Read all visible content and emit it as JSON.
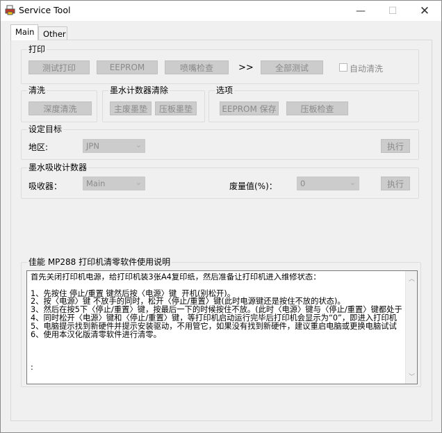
{
  "window": {
    "title": "Service Tool"
  },
  "controls": {
    "minimize": "—",
    "maximize": "☐",
    "close": "✕"
  },
  "tabs": [
    {
      "label": "Main"
    },
    {
      "label": "Other"
    }
  ],
  "print_group": {
    "title": "打印",
    "test_print": "测试打印",
    "eeprom": "EEPROM",
    "nozzle_check": "喷嘴检查",
    "arrow": ">>",
    "all_tests": "全部测试",
    "auto_clean_label": "自动清洗",
    "auto_clean_checked": false
  },
  "clean_group": {
    "title": "清洗",
    "deep_clean": "深度清洗"
  },
  "ink_counter_group": {
    "title": "墨水计数器清除",
    "main_pad": "主废墨垫",
    "platen_pad": "压板墨垫"
  },
  "options_group": {
    "title": "选项",
    "eeprom_save": "EEPROM 保存",
    "platen_check": "压板检查"
  },
  "target_group": {
    "title": "设定目标",
    "region_label": "地区:",
    "region_value": "JPN",
    "execute": "执行"
  },
  "absorber_group": {
    "title": "墨水吸收计数器",
    "absorber_label": "吸收器：",
    "absorber_value": "Main",
    "waste_label": "废量值(%)：",
    "waste_value": "0",
    "execute": "执行"
  },
  "manual": {
    "title": "佳能 MP288 打印机清零软件使用说明",
    "lines": [
      "首先关闭打印机电源，给打印机装3张A4复印纸，然后准备让打印机进入维修状态：",
      "",
      "1、先按住 停止/重置 键然后按〈电源〉键  开机(别松开)。",
      "2、按〈电源〉键 不放手的同时，松开〈停止/重置〉键(此时电源键还是按住不放的状态)。",
      "3、然后在按5下〈停止/重置〉键，按最后一下的时候按住不放。(此时〈电源〉键与〈停止/重置〉键都处于按",
      "4、同时松开〈电源〉键和〈停止/重置〉键，等打印机启动运行完毕后打印机会显示为“0”，即进入打印机",
      "5、电脑提示找到新硬件并提示安装驱动，不用管它，如果没有找到新硬件，建议重启电脑或更换电脑试试",
      "6、使用本汉化版清零软件进行清零。",
      "",
      "",
      "",
      ":"
    ]
  }
}
